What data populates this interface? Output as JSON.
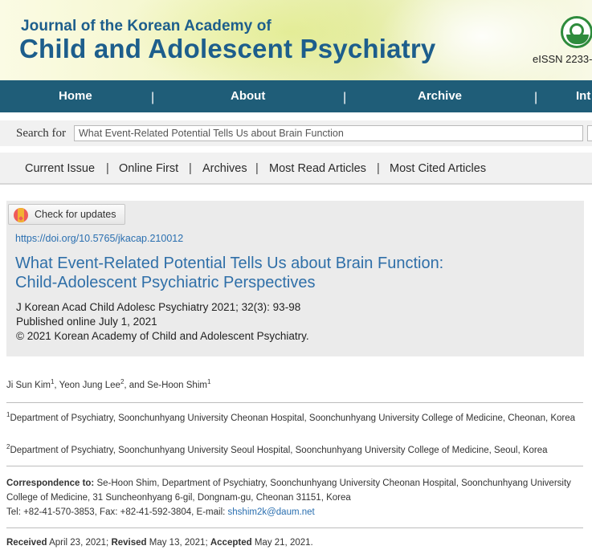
{
  "header": {
    "journal_line1": "Journal of the Korean Academy of",
    "journal_line2": "Child and Adolescent Psychiatry",
    "eissn": "eISSN 2233-"
  },
  "nav": {
    "items": [
      {
        "label": "Home"
      },
      {
        "label": "About"
      },
      {
        "label": "Archive"
      },
      {
        "label": "Int"
      }
    ],
    "separator": "|"
  },
  "search": {
    "label": "Search for",
    "value": "What Event-Related Potential Tells Us about Brain Function"
  },
  "submenu": {
    "items": [
      {
        "label": "Current Issue"
      },
      {
        "label": "Online First"
      },
      {
        "label": "Archives"
      },
      {
        "label": "Most Read Articles"
      },
      {
        "label": "Most Cited Articles"
      }
    ],
    "separator": "|"
  },
  "article": {
    "check_updates": "Check for updates",
    "doi": "https://doi.org/10.5765/jkacap.210012",
    "title_line1": "What Event-Related Potential Tells Us about Brain Function:",
    "title_line2": "Child-Adolescent Psychiatric Perspectives",
    "citation": "J Korean Acad Child Adolesc Psychiatry 2021; 32(3): 93-98",
    "published": "Published online July 1, 2021",
    "copyright": "© 2021 Korean Academy of Child and Adolescent Psychiatry."
  },
  "authors": [
    {
      "name": "Ji Sun Kim",
      "aff": "1",
      "sep": ", "
    },
    {
      "name": "Yeon Jung Lee",
      "aff": "2",
      "sep": ", and "
    },
    {
      "name": "Se-Hoon Shim",
      "aff": "1",
      "sep": ""
    }
  ],
  "affiliations": [
    {
      "num": "1",
      "text": "Department of Psychiatry, Soonchunhyang University Cheonan Hospital, Soonchunhyang University College of Medicine, Cheonan, Korea"
    },
    {
      "num": "2",
      "text": "Department of Psychiatry, Soonchunhyang University Seoul Hospital, Soonchunhyang University College of Medicine, Seoul, Korea"
    }
  ],
  "correspondence": {
    "label": "Correspondence to:",
    "text": "Se-Hoon Shim, Department of Psychiatry, Soonchunhyang University Cheonan Hospital, Soonchunhyang University College of Medicine, 31 Suncheonhyang 6-gil, Dongnam-gu, Cheonan 31151, Korea",
    "contact": "Tel: +82-41-570-3853, Fax: +82-41-592-3804, E-mail: ",
    "email": "shshim2k@daum.net"
  },
  "dates": {
    "received_label": "Received",
    "received": "April 23, 2021;",
    "revised_label": "Revised",
    "revised": "May 13, 2021;",
    "accepted_label": "Accepted",
    "accepted": "May 21, 2021."
  }
}
